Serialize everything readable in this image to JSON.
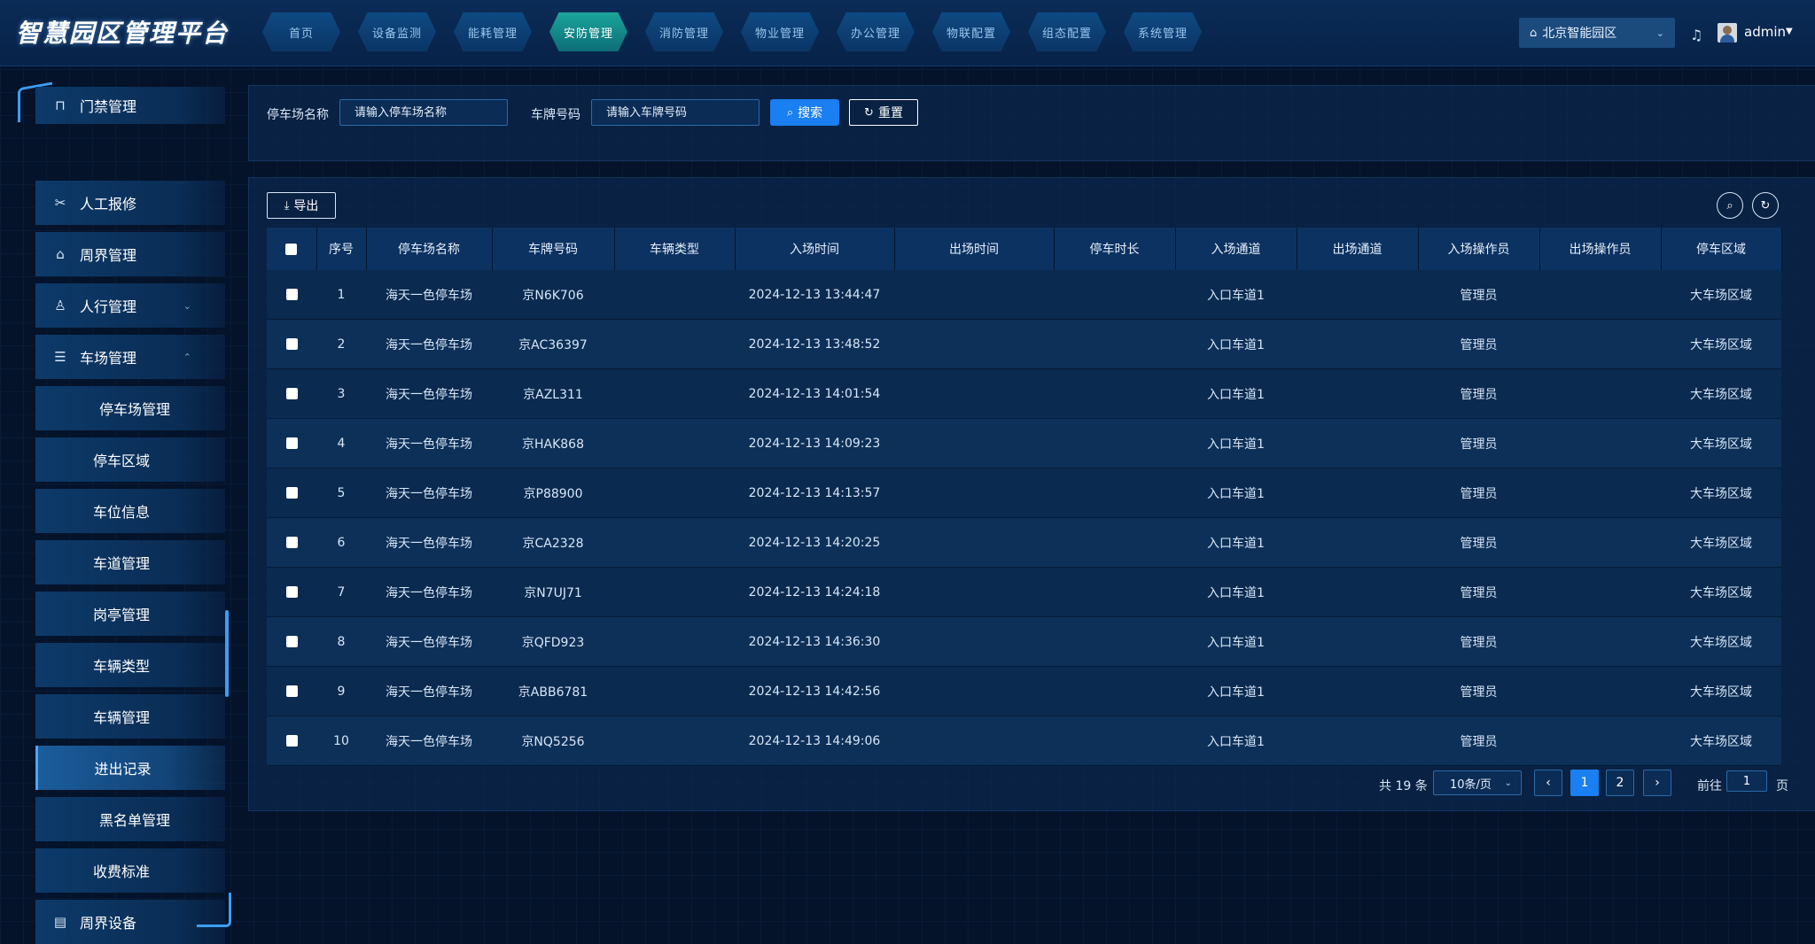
{
  "header": {
    "title": "智慧园区管理平台",
    "nav": [
      "首页",
      "设备监测",
      "能耗管理",
      "安防管理",
      "消防管理",
      "物业管理",
      "办公管理",
      "物联配置",
      "组态配置",
      "系统管理"
    ],
    "nav_active": "安防管理",
    "park_select": "北京智能园区",
    "username": "admin"
  },
  "sidebar": {
    "items": [
      {
        "label": "门禁管理",
        "icon": "gate-icon"
      },
      {
        "label": "人工报修",
        "icon": "tools-icon"
      },
      {
        "label": "周界管理",
        "icon": "building-icon"
      },
      {
        "label": "人行管理",
        "icon": "person-icon"
      },
      {
        "label": "车场管理",
        "icon": "parking-icon"
      },
      {
        "label": "停车场管理"
      },
      {
        "label": "停车区域"
      },
      {
        "label": "车位信息"
      },
      {
        "label": "车道管理"
      },
      {
        "label": "岗亭管理"
      },
      {
        "label": "车辆类型"
      },
      {
        "label": "车辆管理"
      },
      {
        "label": "进出记录",
        "active": true
      },
      {
        "label": "黑名单管理"
      },
      {
        "label": "收费标准"
      },
      {
        "label": "周界设备",
        "icon": "device-icon"
      }
    ]
  },
  "filters": {
    "parking_name_label": "停车场名称",
    "parking_name_placeholder": "请输入停车场名称",
    "plate_label": "车牌号码",
    "plate_placeholder": "请输入车牌号码",
    "search_label": "搜索",
    "reset_label": "重置"
  },
  "toolbar": {
    "export_label": "导出"
  },
  "table": {
    "columns": [
      "序号",
      "停车场名称",
      "车牌号码",
      "车辆类型",
      "入场时间",
      "出场时间",
      "停车时长",
      "入场通道",
      "出场通道",
      "入场操作员",
      "出场操作员",
      "停车区域"
    ],
    "rows": [
      [
        "1",
        "海天一色停车场",
        "京N6K706",
        "",
        "2024-12-13 13:44:47",
        "",
        "",
        "入口车道1",
        "",
        "管理员",
        "",
        "大车场区域"
      ],
      [
        "2",
        "海天一色停车场",
        "京AC36397",
        "",
        "2024-12-13 13:48:52",
        "",
        "",
        "入口车道1",
        "",
        "管理员",
        "",
        "大车场区域"
      ],
      [
        "3",
        "海天一色停车场",
        "京AZL311",
        "",
        "2024-12-13 14:01:54",
        "",
        "",
        "入口车道1",
        "",
        "管理员",
        "",
        "大车场区域"
      ],
      [
        "4",
        "海天一色停车场",
        "京HAK868",
        "",
        "2024-12-13 14:09:23",
        "",
        "",
        "入口车道1",
        "",
        "管理员",
        "",
        "大车场区域"
      ],
      [
        "5",
        "海天一色停车场",
        "京P88900",
        "",
        "2024-12-13 14:13:57",
        "",
        "",
        "入口车道1",
        "",
        "管理员",
        "",
        "大车场区域"
      ],
      [
        "6",
        "海天一色停车场",
        "京CA2328",
        "",
        "2024-12-13 14:20:25",
        "",
        "",
        "入口车道1",
        "",
        "管理员",
        "",
        "大车场区域"
      ],
      [
        "7",
        "海天一色停车场",
        "京N7UJ71",
        "",
        "2024-12-13 14:24:18",
        "",
        "",
        "入口车道1",
        "",
        "管理员",
        "",
        "大车场区域"
      ],
      [
        "8",
        "海天一色停车场",
        "京QFD923",
        "",
        "2024-12-13 14:36:30",
        "",
        "",
        "入口车道1",
        "",
        "管理员",
        "",
        "大车场区域"
      ],
      [
        "9",
        "海天一色停车场",
        "京ABB6781",
        "",
        "2024-12-13 14:42:56",
        "",
        "",
        "入口车道1",
        "",
        "管理员",
        "",
        "大车场区域"
      ],
      [
        "10",
        "海天一色停车场",
        "京NQ5256",
        "",
        "2024-12-13 14:49:06",
        "",
        "",
        "入口车道1",
        "",
        "管理员",
        "",
        "大车场区域"
      ]
    ]
  },
  "pagination": {
    "total_text": "共 19 条",
    "page_size": "10条/页",
    "pages": [
      "1",
      "2"
    ],
    "current_page": "1",
    "goto_label": "前往",
    "goto_value": "1",
    "goto_unit": "页"
  }
}
